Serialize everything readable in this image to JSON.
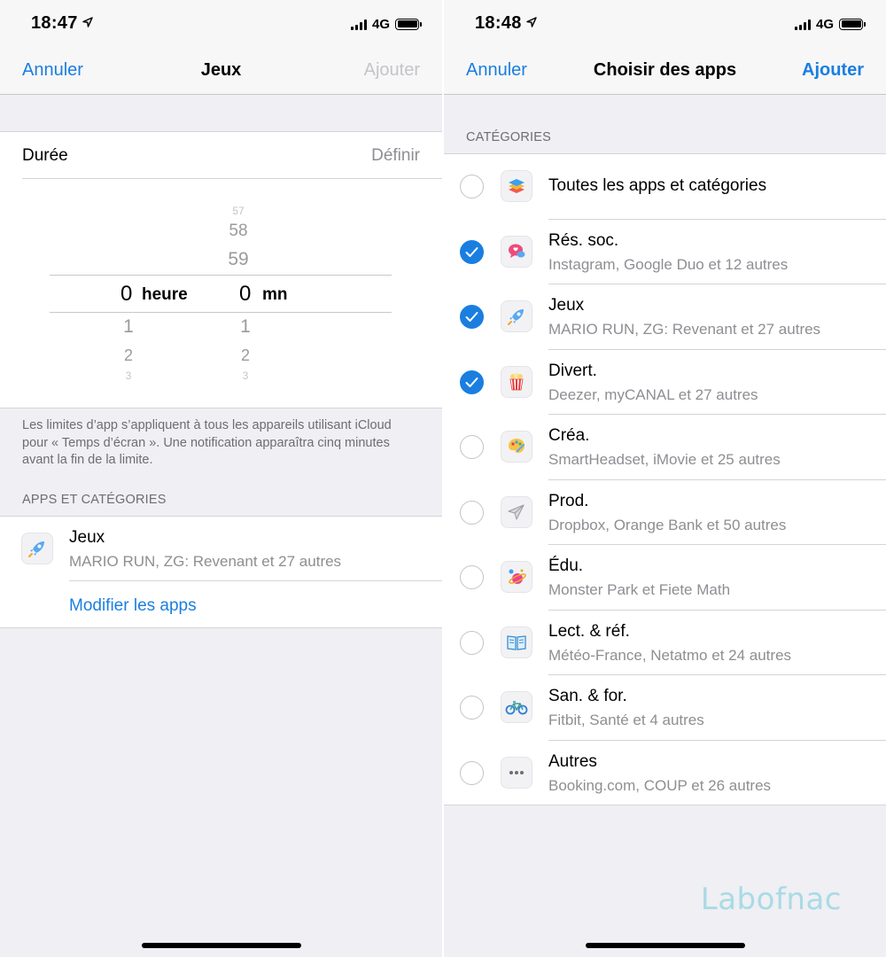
{
  "left": {
    "status": {
      "time": "18:47",
      "network": "4G"
    },
    "nav": {
      "cancel": "Annuler",
      "title": "Jeux",
      "add": "Ajouter"
    },
    "duration": {
      "label": "Durée",
      "value": "Définir"
    },
    "picker": {
      "hours_above": [
        "57",
        "58",
        "59"
      ],
      "selected_hours": "0",
      "hours_unit": "heure",
      "selected_minutes": "0",
      "minutes_unit": "mn",
      "below": [
        "1",
        "2",
        "3"
      ]
    },
    "footnote": "Les limites d’app s’appliquent à tous les appareils utilisant iCloud pour « Temps d’écran ». Une notification apparaîtra cinq minutes avant la fin de la limite.",
    "section_header": "APPS ET CATÉGORIES",
    "app": {
      "title": "Jeux",
      "subtitle": "MARIO RUN, ZG: Revenant et 27 autres",
      "icon": "rocket-icon"
    },
    "modify_link": "Modifier les apps"
  },
  "right": {
    "status": {
      "time": "18:48",
      "network": "4G"
    },
    "nav": {
      "cancel": "Annuler",
      "title": "Choisir des apps",
      "add": "Ajouter"
    },
    "section_header": "CATÉGORIES",
    "categories": [
      {
        "title": "Toutes les apps et catégories",
        "subtitle": "",
        "checked": false,
        "icon": "stack-icon"
      },
      {
        "title": "Rés. soc.",
        "subtitle": "Instagram, Google Duo et 12 autres",
        "checked": true,
        "icon": "chat-bubble-icon"
      },
      {
        "title": "Jeux",
        "subtitle": "MARIO RUN, ZG: Revenant et 27 autres",
        "checked": true,
        "icon": "rocket-icon"
      },
      {
        "title": "Divert.",
        "subtitle": "Deezer, myCANAL et 27 autres",
        "checked": true,
        "icon": "popcorn-icon"
      },
      {
        "title": "Créa.",
        "subtitle": "SmartHeadset, iMovie et 25 autres",
        "checked": false,
        "icon": "palette-icon"
      },
      {
        "title": "Prod.",
        "subtitle": "Dropbox, Orange Bank et 50 autres",
        "checked": false,
        "icon": "paper-plane-icon"
      },
      {
        "title": "Édu.",
        "subtitle": "Monster Park et Fiete Math",
        "checked": false,
        "icon": "planet-icon"
      },
      {
        "title": "Lect. & réf.",
        "subtitle": "Météo-France, Netatmo et 24 autres",
        "checked": false,
        "icon": "book-icon"
      },
      {
        "title": "San. & for.",
        "subtitle": "Fitbit, Santé et 4 autres",
        "checked": false,
        "icon": "bicycle-icon"
      },
      {
        "title": "Autres",
        "subtitle": "Booking.com, COUP et 26 autres",
        "checked": false,
        "icon": "ellipsis-icon"
      }
    ]
  },
  "watermark": "Labofnac",
  "colors": {
    "accent": "#1a7ee0",
    "background": "#efeff4",
    "secondary_text": "#8e8e93"
  }
}
